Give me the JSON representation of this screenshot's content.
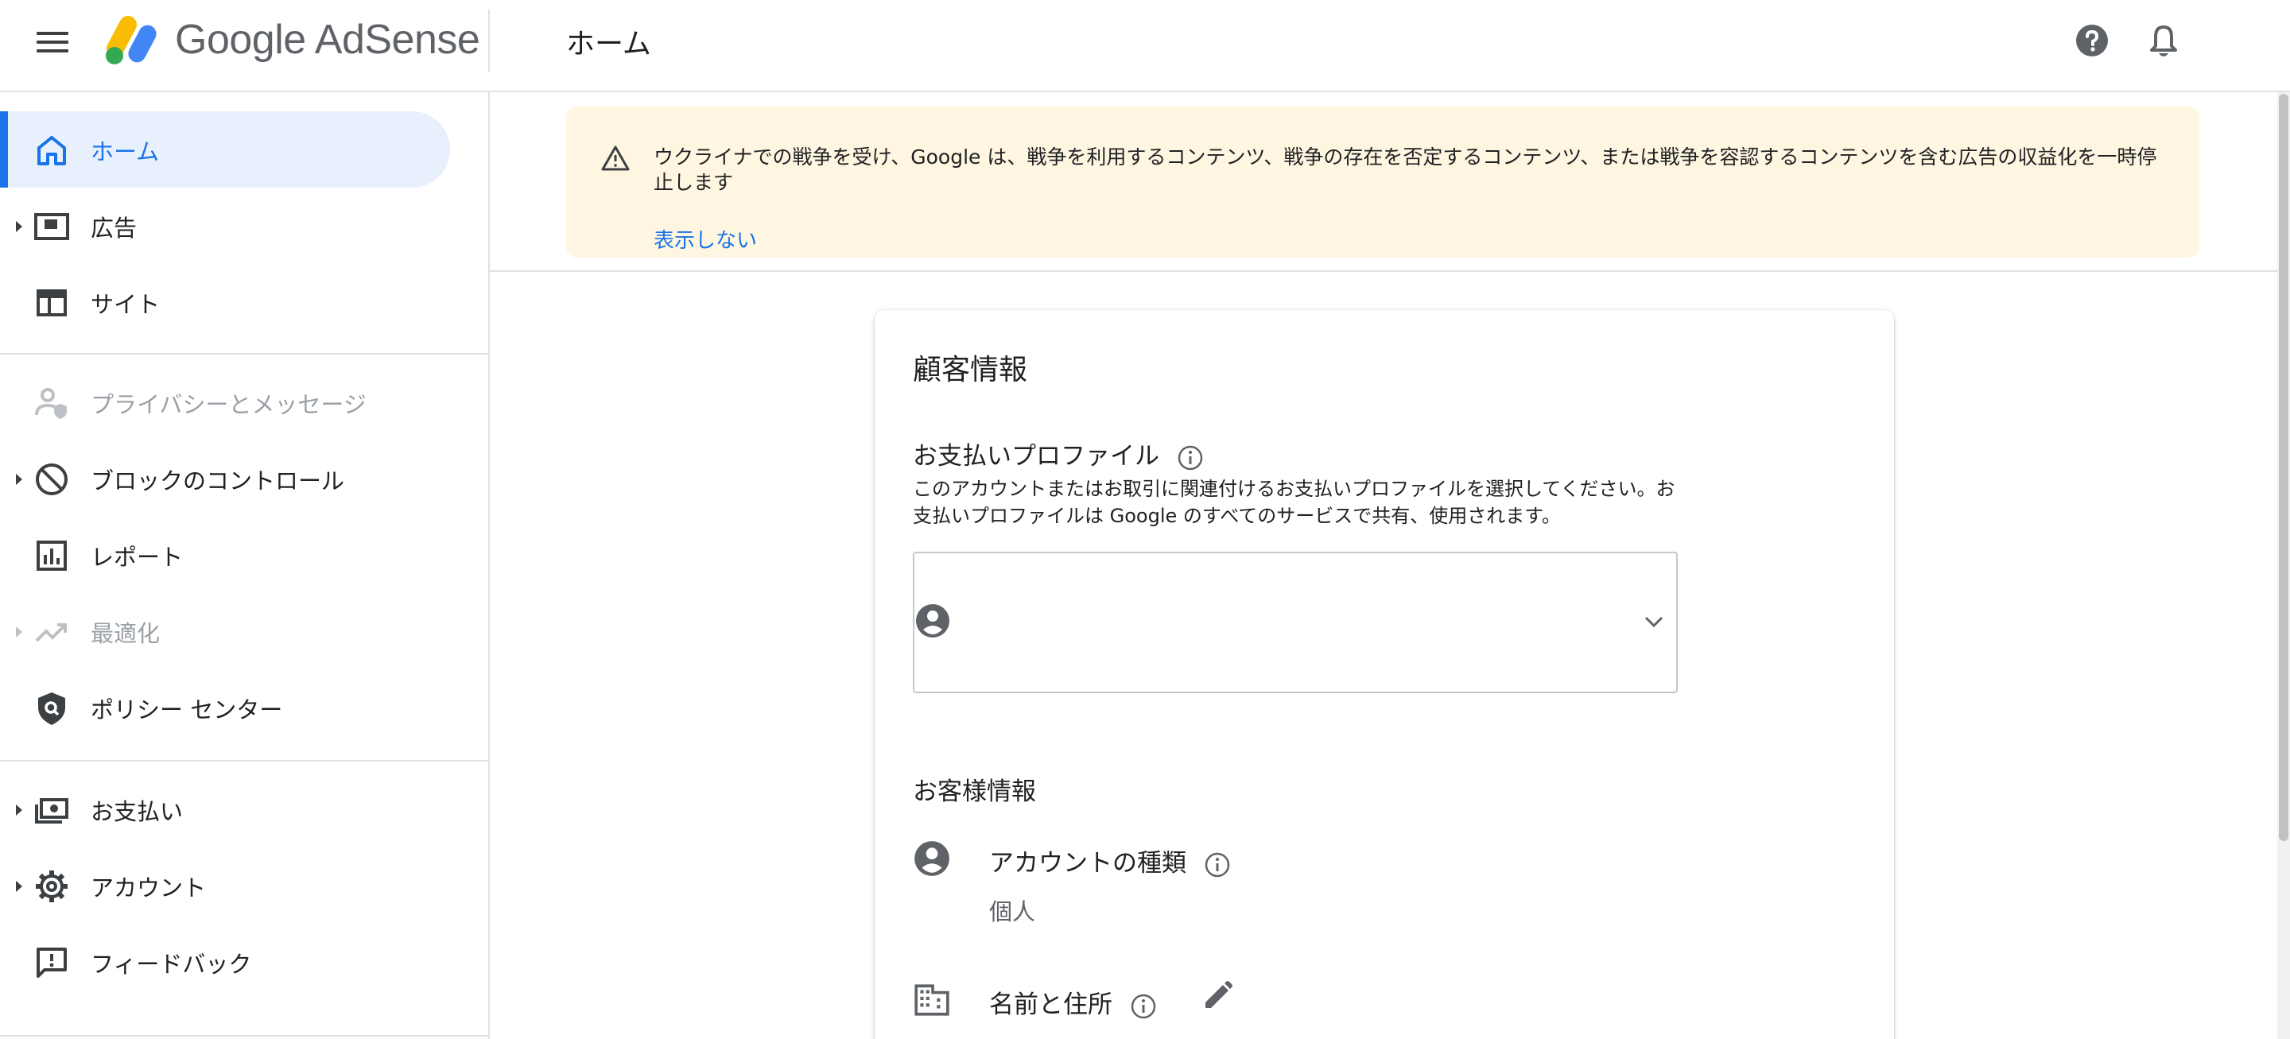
{
  "app": {
    "logo_text": "Google AdSense",
    "page_title": "ホーム",
    "accent_color": "#1a73e8"
  },
  "header": {
    "help_icon": "help-circle-icon",
    "notifications_icon": "bell-icon"
  },
  "sidebar": {
    "items": [
      {
        "label": "ホーム",
        "icon": "home-icon",
        "active": true,
        "expandable": false,
        "disabled": false
      },
      {
        "label": "広告",
        "icon": "ads-icon",
        "active": false,
        "expandable": true,
        "disabled": false
      },
      {
        "label": "サイト",
        "icon": "sites-icon",
        "active": false,
        "expandable": false,
        "disabled": false
      },
      {
        "label": "プライバシーとメッセージ",
        "icon": "privacy-icon",
        "active": false,
        "expandable": false,
        "disabled": true
      },
      {
        "label": "ブロックのコントロール",
        "icon": "block-icon",
        "active": false,
        "expandable": true,
        "disabled": false
      },
      {
        "label": "レポート",
        "icon": "report-icon",
        "active": false,
        "expandable": false,
        "disabled": false
      },
      {
        "label": "最適化",
        "icon": "trending-up-icon",
        "active": false,
        "expandable": true,
        "disabled": true
      },
      {
        "label": "ポリシー センター",
        "icon": "policy-shield-icon",
        "active": false,
        "expandable": false,
        "disabled": false
      },
      {
        "label": "お支払い",
        "icon": "payments-icon",
        "active": false,
        "expandable": true,
        "disabled": false
      },
      {
        "label": "アカウント",
        "icon": "gear-icon",
        "active": false,
        "expandable": true,
        "disabled": false
      },
      {
        "label": "フィードバック",
        "icon": "feedback-icon",
        "active": false,
        "expandable": false,
        "disabled": false
      }
    ]
  },
  "banner": {
    "text": "ウクライナでの戦争を受け、Google は、戦争を利用するコンテンツ、戦争の存在を否定するコンテンツ、または戦争を容認するコンテンツを含む広告の収益化を一時停止します",
    "dismiss_label": "表示しない",
    "background_color": "#fef6e0"
  },
  "card": {
    "title": "顧客情報",
    "payment_profile": {
      "label": "お支払いプロファイル",
      "description": "このアカウントまたはお取引に関連付けるお支払いプロファイルを選択してください。お支払いプロファイルは Google のすべてのサービスで共有、使用されます。",
      "selected_value": ""
    },
    "customer_info": {
      "title": "お客様情報",
      "account_type_label": "アカウントの種類",
      "account_type_value": "個人",
      "name_address_label": "名前と住所"
    }
  }
}
